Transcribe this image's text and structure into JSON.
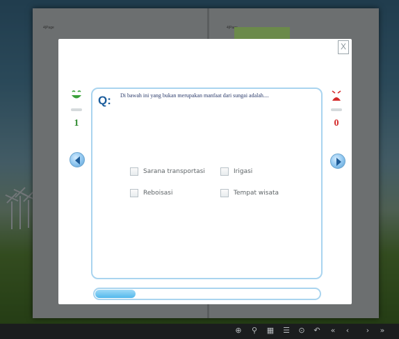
{
  "book": {
    "left_page_label": "4|Page",
    "right_page_label": "4|Page"
  },
  "quiz": {
    "close_label": "X",
    "correct_count": "1",
    "wrong_count": "0",
    "question_marker": "Q:",
    "question": "Di bawah ini yang bukan merupakan manfaat dari sungai adalah....",
    "options": [
      {
        "label": "Sarana transportasi",
        "checked": false
      },
      {
        "label": "Irigasi",
        "checked": false
      },
      {
        "label": "Reboisasi",
        "checked": false
      },
      {
        "label": "Tempat wisata",
        "checked": false
      }
    ],
    "progress_fraction": 0.18
  },
  "toolbar": {
    "icons": [
      "zoom-in-icon",
      "zoom-out-icon",
      "thumbnails-icon",
      "table-of-contents-icon",
      "autoplay-icon",
      "undo-icon",
      "first-page-icon",
      "previous-page-icon",
      "next-page-icon",
      "last-page-icon"
    ]
  },
  "colors": {
    "accent_blue": "#a9d4ef",
    "correct_green": "#2f8a2f",
    "wrong_red": "#d42a2a",
    "question_blue": "#1c5d9c"
  }
}
